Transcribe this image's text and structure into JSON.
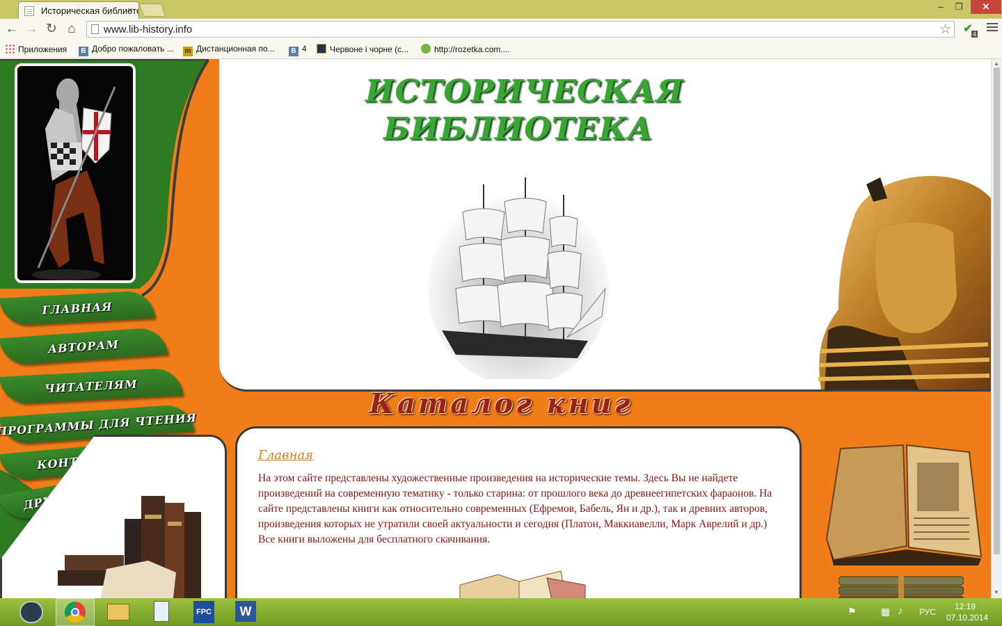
{
  "browser": {
    "tab_title": "Историческая библиотек",
    "tab_close": "×",
    "url": "www.lib-history.info",
    "extension_badge": "4",
    "window_controls": {
      "minimize": "–",
      "maximize": "❐",
      "close": "✕"
    }
  },
  "bookmarks": [
    {
      "label": "Приложения",
      "icon": "apps-grid-icon"
    },
    {
      "label": "Добро пожаловать ...",
      "icon": "vk-icon",
      "icon_text": "B"
    },
    {
      "label": "Дистанционная по...",
      "icon": "distance-icon",
      "icon_text": "m"
    },
    {
      "label": "4",
      "icon": "vk-icon",
      "icon_text": "B"
    },
    {
      "label": "Червоне і чорне (с...",
      "icon": "book-icon",
      "icon_text": ""
    },
    {
      "label": "http://rozetka.com....",
      "icon": "rozetka-icon",
      "icon_text": ""
    }
  ],
  "site": {
    "title_line1": "ИСТОРИЧЕСКАЯ",
    "title_line2": "БИБЛИОТЕКА",
    "catalog_title": "Каталог книг",
    "nav": [
      "ГЛАВНАЯ",
      "АВТОРАМ",
      "ЧИТАТЕЛЯМ",
      "ПРОГРАММЫ ДЛЯ ЧТЕНИЯ",
      "КОНТАКТЫ",
      "ДРУЗЬЯ"
    ],
    "breadcrumb": "Главная",
    "intro_text": "На этом сайте представлены художественные произведения на исторические темы. Здесь Вы не найдете произведений на современную тематику - только старина: от прошлого века до древнеегипетских фараонов. На сайте представлены книги как относительно современных (Ефремов, Бабель, Ян и др.), так и древних авторов, произведения которых не утратили своей актуальности и сегодня (Платон, Маккиавелли, Марк Аврелий и др.)",
    "intro_text2": "Все книги выложены для бесплатного скачивания."
  },
  "colors": {
    "chrome": "#c9c868",
    "site_orange": "#f07d18",
    "site_green": "#2e7a22",
    "text_red": "#8c1414",
    "link_orange": "#e37a1a"
  },
  "taskbar": {
    "apps": [
      "steam-icon",
      "chrome-icon",
      "file-explorer-icon",
      "calculator-icon",
      "fpc-icon",
      "word-icon"
    ],
    "lang": "РУС",
    "time": "12:19",
    "date": "07.10.2014"
  }
}
